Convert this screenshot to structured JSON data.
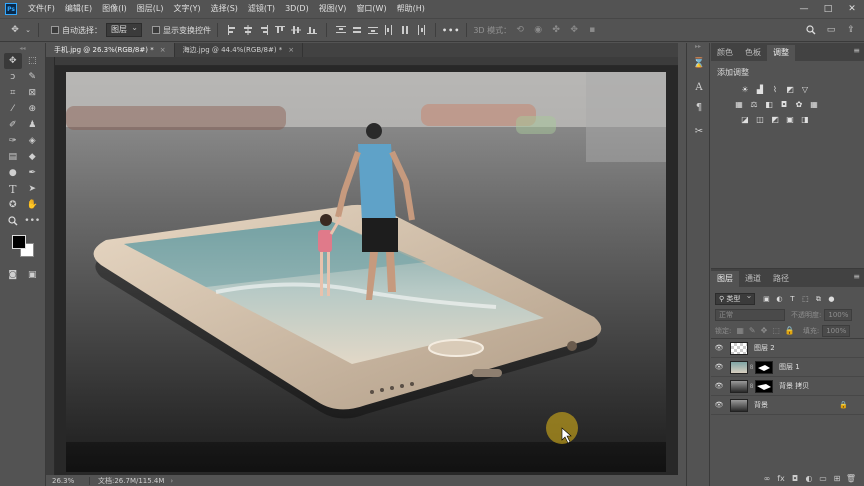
{
  "app": {
    "logo": "Ps"
  },
  "menu": [
    "文件(F)",
    "编辑(E)",
    "图像(I)",
    "图层(L)",
    "文字(Y)",
    "选择(S)",
    "滤镜(T)",
    "3D(D)",
    "视图(V)",
    "窗口(W)",
    "帮助(H)"
  ],
  "window_controls": {
    "minimize": "—",
    "maximize": "□",
    "close": "✕"
  },
  "options": {
    "auto_select_label": "自动选择：",
    "auto_select_value": "图层",
    "show_transform_label": "显示变换控件",
    "more": "•••",
    "mode_3d_label": "3D 模式："
  },
  "tabs": [
    {
      "label": "手机.jpg @ 26.3%(RGB/8#) *",
      "active": true
    },
    {
      "label": "海边.jpg @ 44.4%(RGB/8#) *",
      "active": false
    }
  ],
  "status": {
    "zoom": "26.3%",
    "doc": "文档:26.7M/115.4M"
  },
  "panels": {
    "top_tabs": [
      "颜色",
      "色板",
      "调整"
    ],
    "active_top_tab": "调整",
    "adjust_title": "添加调整",
    "layers_tabs": [
      "图层",
      "通道",
      "路径"
    ],
    "filter_kind": "类型",
    "blend_mode": "正常",
    "opacity_label": "不透明度:",
    "opacity_value": "100%",
    "lock_label": "锁定:",
    "fill_label": "填充:",
    "fill_value": "100%"
  },
  "layers": [
    {
      "name": "图层 2",
      "visible": true,
      "has_mask": false,
      "locked": false
    },
    {
      "name": "图层 1",
      "visible": true,
      "has_mask": true,
      "locked": false
    },
    {
      "name": "背景 拷贝",
      "visible": true,
      "has_mask": true,
      "locked": false
    },
    {
      "name": "背景",
      "visible": true,
      "has_mask": false,
      "locked": true
    }
  ],
  "colors": {
    "accent": "#31a8ff",
    "ui_bg": "#535353",
    "canvas_bg": "#282828",
    "foreground": "#000000",
    "background": "#ffffff"
  },
  "tool_icons": [
    "move-icon",
    "marquee-icon",
    "lasso-icon",
    "magic-wand-icon",
    "crop-icon",
    "frame-icon",
    "eyedropper-icon",
    "healing-icon",
    "brush-icon",
    "stamp-icon",
    "history-brush-icon",
    "eraser-icon",
    "gradient-icon",
    "blur-icon",
    "dodge-icon",
    "pen-icon",
    "type-icon",
    "path-select-icon",
    "shape-icon",
    "hand-icon",
    "zoom-icon",
    "more-tools-icon"
  ]
}
